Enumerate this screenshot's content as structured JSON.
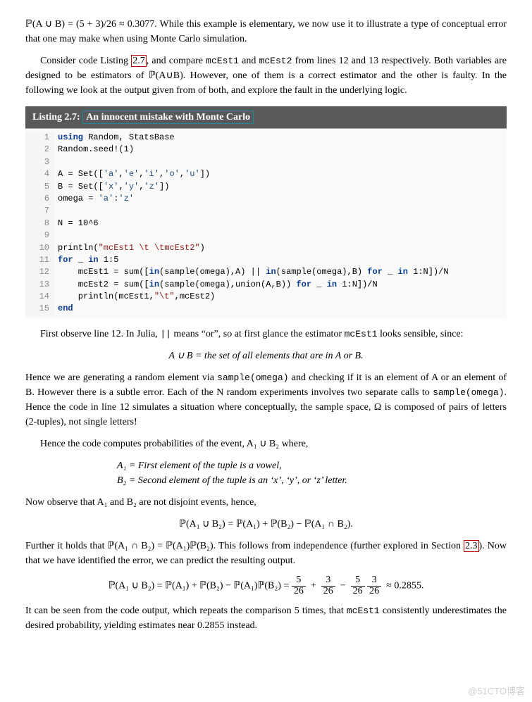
{
  "para1": "ℙ(A ∪ B) = (5 + 3)/26 ≈ 0.3077. While this example is elementary, we now use it to illustrate a type of conceptual error that one may make when using Monte Carlo simulation.",
  "para2_a": "Consider code Listing ",
  "para2_ref": "2.7",
  "para2_b": ", and compare ",
  "para2_c": "mcEst1",
  "para2_d": " and ",
  "para2_e": "mcEst2",
  "para2_f": " from lines 12 and 13 respectively. Both variables are designed to be estimators of ℙ(A∪B). However, one of them is a correct estimator and the other is faulty. In the following we look at the output given from of both, and explore the fault in the underlying logic.",
  "listing": {
    "label": "Listing 2.7:",
    "title": "An innocent mistake with Monte Carlo",
    "lines": [
      {
        "n": "1",
        "code": "<span class='kw'>using</span> Random, StatsBase"
      },
      {
        "n": "2",
        "code": "Random.seed!(1)"
      },
      {
        "n": "3",
        "code": ""
      },
      {
        "n": "4",
        "code": "A = Set([<span class='chr'>'a'</span>,<span class='chr'>'e'</span>,<span class='chr'>'i'</span>,<span class='chr'>'o'</span>,<span class='chr'>'u'</span>])"
      },
      {
        "n": "5",
        "code": "B = Set([<span class='chr'>'x'</span>,<span class='chr'>'y'</span>,<span class='chr'>'z'</span>])"
      },
      {
        "n": "6",
        "code": "omega = <span class='chr'>'a'</span>:<span class='chr'>'z'</span>"
      },
      {
        "n": "7",
        "code": ""
      },
      {
        "n": "8",
        "code": "N = 10^6"
      },
      {
        "n": "9",
        "code": ""
      },
      {
        "n": "10",
        "code": "println(<span class='str'>\"mcEst1 \\t \\tmcEst2\"</span>)"
      },
      {
        "n": "11",
        "code": "<span class='kw'>for</span> _ <span class='kw'>in</span> 1:5"
      },
      {
        "n": "12",
        "code": "    mcEst1 = sum([<span class='kw'>in</span>(sample(omega),A) || <span class='kw'>in</span>(sample(omega),B) <span class='kw'>for</span> _ <span class='kw'>in</span> 1:N])/N"
      },
      {
        "n": "13",
        "code": "    mcEst2 = sum([<span class='kw'>in</span>(sample(omega),union(A,B)) <span class='kw'>for</span> _ <span class='kw'>in</span> 1:N])/N"
      },
      {
        "n": "14",
        "code": "    println(mcEst1,<span class='str'>\"\\t\"</span>,mcEst2)"
      },
      {
        "n": "15",
        "code": "<span class='kw'>end</span>"
      }
    ]
  },
  "para3_a": "First observe line 12. In Julia, ",
  "para3_b": "||",
  "para3_c": " means “or”, so at first glance the estimator ",
  "para3_d": "mcEst1",
  "para3_e": " looks sensible, since:",
  "mathline1": "A ∪ B = the set of all elements that are in A or B.",
  "para4_a": "Hence we are generating a random element via ",
  "para4_b": "sample(omega)",
  "para4_c": " and checking if it is an element of A or an element of B. However there is a subtle error. Each of the N random experiments involves two separate calls to ",
  "para4_d": "sample(omega)",
  "para4_e": ". Hence the code in line 12 simulates a situation where conceptually, the sample space, Ω is composed of pairs of letters (2-tuples), not single letters!",
  "para5": "Hence the code computes probabilities of the event, A₁ ∪ B₂ where,",
  "defA1": "A₁ = First element of the tuple is a vowel,",
  "defB2": "B₂ = Second element of the tuple is an ‘x’, ‘y’, or ‘z’ letter.",
  "para6": "Now observe that A₁ and B₂ are not disjoint events, hence,",
  "mathline2": "ℙ(A₁ ∪ B₂) = ℙ(A₁) + ℙ(B₂) − ℙ(A₁ ∩ B₂).",
  "para7_a": "Further it holds that ℙ(A₁ ∩ B₂) = ℙ(A₁)ℙ(B₂). This follows from independence (further explored in Section ",
  "para7_ref": "2.3",
  "para7_b": "). Now that we have identified the error, we can predict the resulting output.",
  "final_eq_lhs": "ℙ(A₁ ∪ B₂) = ℙ(A₁) + ℙ(B₂) − ℙ(A₁)ℙ(B₂) =",
  "frac1_num": "5",
  "frac1_den": "26",
  "frac2_num": "3",
  "frac2_den": "26",
  "frac3_num": "5",
  "frac3_den": "26",
  "frac4_num": "3",
  "frac4_den": "26",
  "final_eq_approx": "≈ 0.2855.",
  "para8_a": "It can be seen from the code output, which repeats the comparison 5 times, that ",
  "para8_b": "mcEst1",
  "para8_c": " consistently underestimates the desired probability, yielding estimates near 0.2855 instead.",
  "watermark": "@51CTO博客"
}
